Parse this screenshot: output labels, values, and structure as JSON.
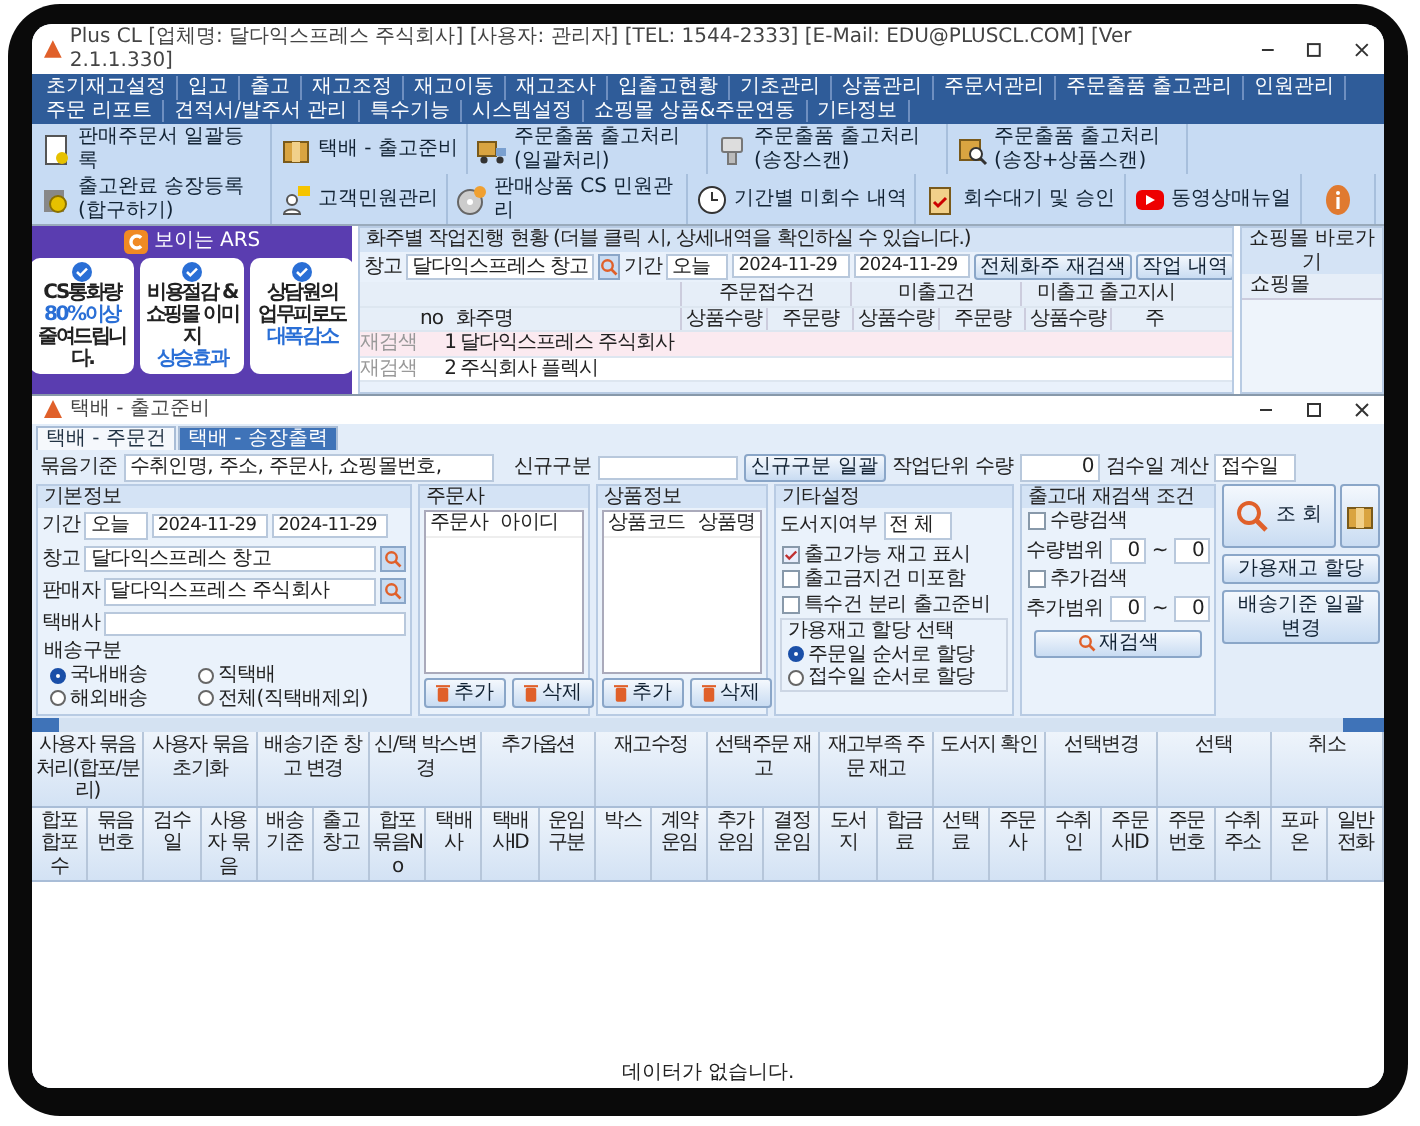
{
  "window": {
    "title": "Plus CL  [업체명: 달다익스프레스 주식회사]  [사용자: 관리자]  [TEL: 1544-2333]  [E-Mail: EDU@PLUSCL.COM]  [Ver 2.1.1.330]"
  },
  "menu": [
    "초기재고설정",
    "입고",
    "출고",
    "재고조정",
    "재고이동",
    "재고조사",
    "입출고현황",
    "기초관리",
    "상품관리",
    "주문서관리",
    "주문출품 출고관리",
    "인원관리",
    "주문 리포트",
    "견적서/발주서 관리",
    "특수기능",
    "시스템설정",
    "쇼핑몰 상품&주문연동",
    "기타정보"
  ],
  "toolbar": [
    {
      "kind": "document",
      "label": "판매주문서 일괄등록"
    },
    {
      "kind": "box",
      "label": "택배 - 출고준비"
    },
    {
      "kind": "truck",
      "label": "주문출품 출고처리(일괄처리)"
    },
    {
      "kind": "scanner",
      "label": "주문출품 출고처리(송장스캔)"
    },
    {
      "kind": "box-search",
      "label": "주문출품 출고처리(송장+상품스캔)"
    },
    {
      "kind": "coin",
      "label": "출고완료 송장등록(합구하기)"
    },
    {
      "kind": "person",
      "label": "고객민원관리"
    },
    {
      "kind": "disc",
      "label": "판매상품 CS 민원관리"
    },
    {
      "kind": "clock",
      "label": "기간별 미회수 내역"
    },
    {
      "kind": "clipboard",
      "label": "회수대기 및 승인"
    },
    {
      "kind": "video",
      "label": "동영상매뉴얼"
    },
    {
      "kind": "info"
    }
  ],
  "banner": {
    "title": "보이는 ARS",
    "cards": [
      {
        "lines": [
          {
            "text": "CS통화량",
            "accent": false
          },
          {
            "text": "80%이상",
            "accent": true
          },
          {
            "text": "줄여드립니다.",
            "accent": false
          }
        ]
      },
      {
        "lines": [
          {
            "text": "비용절감 &",
            "accent": false
          },
          {
            "text": "쇼핑몰 이미지",
            "accent": false
          },
          {
            "text": "상승효과",
            "accent": true
          }
        ]
      },
      {
        "lines": [
          {
            "text": "상담원의",
            "accent": false
          },
          {
            "text": "업무피로도",
            "accent": false
          },
          {
            "text": "대폭감소",
            "accent": true
          }
        ]
      }
    ]
  },
  "progress": {
    "title": "화주별 작업진행 현황 (더블 클릭 시, 상세내역을 확인하실 수 있습니다.)",
    "warehouse_label": "창고",
    "warehouse": "달다익스프레스 창고",
    "period_label": "기간",
    "period": "오늘",
    "date_from": "2024-11-29",
    "date_to": "2024-11-29",
    "buttons": [
      "전체화주 재검색",
      "작업 내역"
    ],
    "groups": [
      "주문접수건",
      "미출고건",
      "미출고 출고지시"
    ],
    "columns": [
      "no",
      "화주명",
      "상품수량",
      "주문량",
      "상품수량",
      "주문량",
      "상품수량",
      "주"
    ],
    "rows": [
      {
        "status": "재검색",
        "no": "1",
        "name": "달다익스프레스 주식회사",
        "selected": true
      },
      {
        "status": "재검색",
        "no": "2",
        "name": "주식회사 플렉시",
        "selected": false
      }
    ]
  },
  "shop": {
    "title": "쇼핑몰 바로가기",
    "column": "쇼핑몰"
  },
  "child": {
    "title": "택배 - 출고준비",
    "tabs": [
      {
        "label": "택배 - 주문건",
        "selected": false
      },
      {
        "label": "택배 - 송장출력",
        "selected": true
      }
    ],
    "bundle_label": "묶음기준",
    "bundle": "수취인명, 주소, 주문사, 쇼핑몰번호,",
    "new_label": "신규구분",
    "new_button": "신규구분 일괄",
    "unit_label": "작업단위 수량",
    "unit": "0",
    "check_label": "검수일 계산",
    "check": "접수일",
    "basic": {
      "title": "기본정보",
      "period_label": "기간",
      "period": "오늘",
      "date_from": "2024-11-29",
      "date_to": "2024-11-29",
      "warehouse_label": "창고",
      "warehouse": "달다익스프레스 창고",
      "seller_label": "판매자",
      "seller": "달다익스프레스 주식회사",
      "courier_label": "택배사",
      "ship_title": "배송구분",
      "ship": [
        {
          "label": "국내배송",
          "selected": true
        },
        {
          "label": "직택배",
          "selected": false
        },
        {
          "label": "해외배송",
          "selected": false
        },
        {
          "label": "전체(직택배제외)",
          "selected": false
        }
      ]
    },
    "orderer": {
      "title": "주문사",
      "columns": [
        "주문사",
        "아이디"
      ],
      "buttons": [
        "추가",
        "삭제"
      ]
    },
    "product": {
      "title": "상품정보",
      "columns": [
        "상품코드",
        "상품명"
      ],
      "buttons": [
        "추가",
        "삭제"
      ]
    },
    "etc": {
      "title": "기타설정",
      "island_label": "도서지여부",
      "island": "전 체",
      "checks": [
        {
          "label": "출고가능 재고 표시",
          "checked": true
        },
        {
          "label": "출고금지건 미포함",
          "checked": false
        },
        {
          "label": "특수건 분리 출고준비",
          "checked": false
        }
      ],
      "alloc_title": "가용재고 할당 선택",
      "alloc": [
        {
          "label": "주문일 순서로 할당",
          "selected": true
        },
        {
          "label": "접수일 순서로 할당",
          "selected": false
        }
      ]
    },
    "research": {
      "title": "출고대 재검색 조건",
      "rows": [
        {
          "check": "수량검색",
          "checked": false,
          "range_label": "수량범위",
          "from": "0",
          "separator": "~",
          "to": "0"
        },
        {
          "check": "추가검색",
          "checked": false,
          "range_label": "추가범위",
          "from": "0",
          "separator": "~",
          "to": "0"
        }
      ],
      "button": "재검색"
    },
    "search_button": "조 회",
    "side_buttons": [
      "가용재고 할당",
      "배송기준 일괄변경"
    ],
    "groups": [
      "사용자 묶음처리(합포/분리)",
      "사용자 묶음 초기화",
      "배송기준 창고 변경",
      "신/택 박스변경",
      "추가옵션",
      "재고수정",
      "선택주문 재고",
      "재고부족 주문 재고",
      "도서지 확인",
      "선택변경",
      "선택",
      "취소"
    ],
    "columns": [
      "합포 합포수",
      "묶음번호",
      "검수일",
      "사용자 묶음",
      "배송기준",
      "출고창고",
      "합포묶음No",
      "택배사",
      "택배사ID",
      "운임구분",
      "박스",
      "계약운임",
      "추가운임",
      "결정운임",
      "도서지",
      "합금료",
      "선택료",
      "주문사",
      "수취인",
      "주문사ID",
      "주문번호",
      "수취주소",
      "포파온",
      "일반전화"
    ],
    "empty": "데이터가 없습니다."
  }
}
